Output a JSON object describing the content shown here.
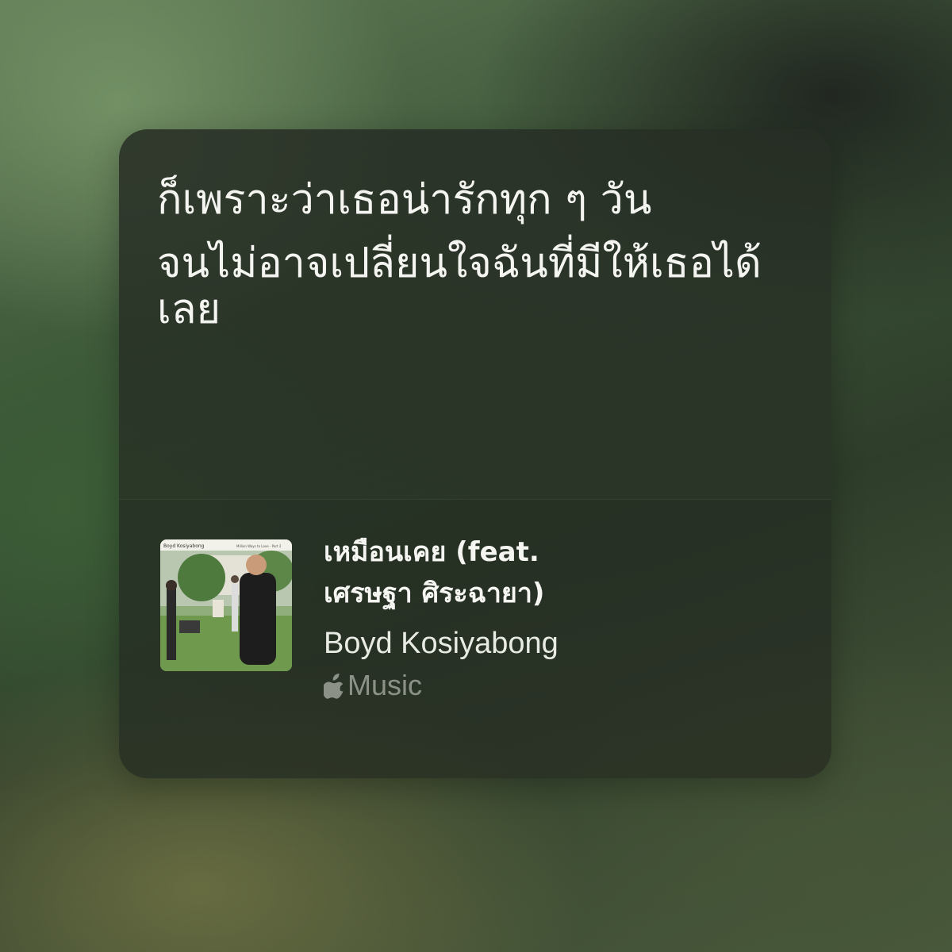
{
  "lyrics": {
    "lines": [
      "ก็เพราะว่าเธอน่ารักทุก ๆ วัน",
      "จนไม่อาจเปลี่ยนใจฉันที่มีให้เธอได้เลย"
    ]
  },
  "track": {
    "title": "เหมือนเคย (feat. เศรษฐา ศิระฉายา)",
    "artist": "Boyd Kosiyabong",
    "album_art_text": {
      "left": "Boyd Kosiyabong",
      "right": "Million Ways to Love - Part 2"
    }
  },
  "service": {
    "icon": "apple-logo-icon",
    "label": "Music"
  }
}
